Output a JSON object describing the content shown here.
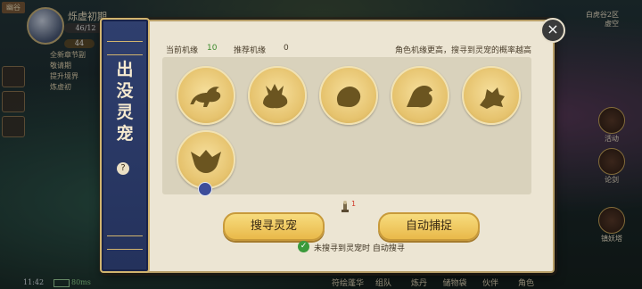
{
  "hud": {
    "player_name": "烁虚初期",
    "level_text": "46/12",
    "exp_text": "44",
    "tag": "幽谷",
    "quest_lines": [
      "全新章节副",
      "敬请期",
      "提升境界",
      "炼虚初"
    ],
    "time": "11:42",
    "network": "80ms",
    "server_lines": [
      "白虎谷2区",
      "虚空"
    ],
    "right_buttons": [
      "活动",
      "论剑",
      "镇妖塔"
    ],
    "bottom_nav": [
      "符绘蓬华",
      "组队",
      "炼丹",
      "储物袋",
      "伙伴",
      "角色"
    ]
  },
  "panel": {
    "title": "出没灵宠",
    "help_icon": "?",
    "close_icon": "×",
    "current_luck_label": "当前机缘",
    "current_luck_value": "10",
    "recommended_luck_label": "推荐机缘",
    "recommended_luck_value": "0",
    "hint": "角色机缘更高，搜寻到灵宠的概率越高",
    "pets": [
      {
        "name": "pet-silhouette-1"
      },
      {
        "name": "pet-silhouette-2"
      },
      {
        "name": "pet-silhouette-3"
      },
      {
        "name": "pet-silhouette-4"
      },
      {
        "name": "pet-silhouette-5"
      },
      {
        "name": "pet-silhouette-6",
        "badge": true
      }
    ],
    "lamp_count": "1",
    "search_button": "搜寻灵宠",
    "catch_button": "自动捕捉",
    "auto_search_label": "未搜寻到灵宠时 自动搜寻",
    "auto_search_checked": true
  },
  "colors": {
    "panel_bg": "#ece5d3",
    "banner_bg": "#2f3f6e",
    "gold": "#e9b94a",
    "luck_value": "#3c8a2c"
  }
}
